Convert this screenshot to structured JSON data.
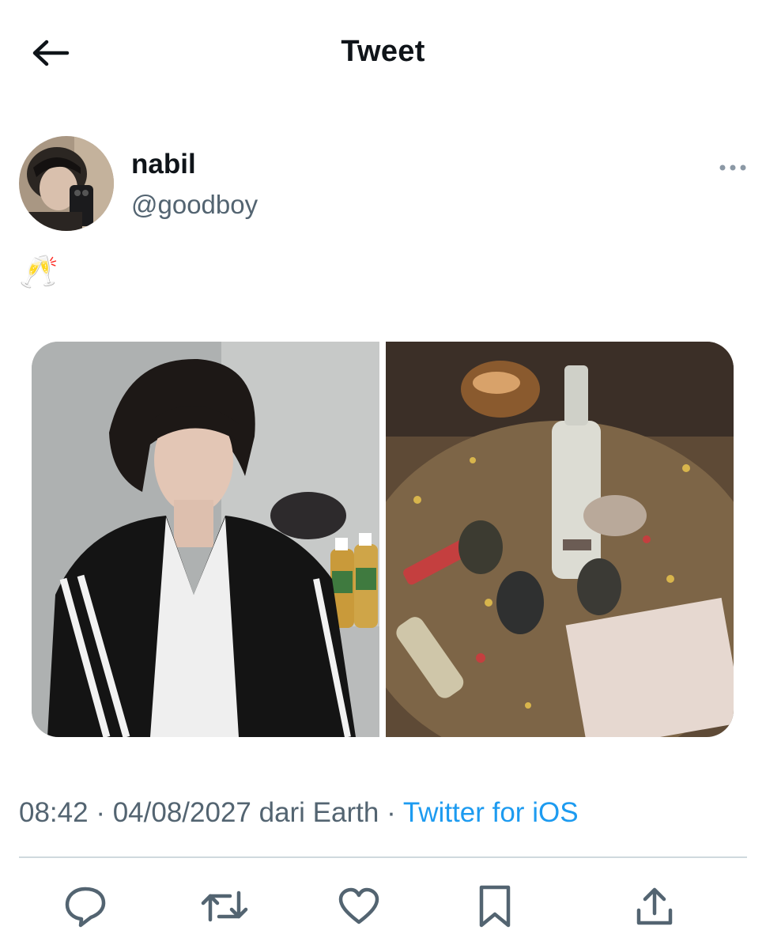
{
  "header": {
    "title": "Tweet",
    "back_icon": "arrow-left-icon"
  },
  "author": {
    "display_name": "nabil",
    "handle": "@goodboy",
    "more_icon": "more-horizontal-icon"
  },
  "tweet": {
    "text": "🥂"
  },
  "media": [
    {
      "icon": "photo-portrait"
    },
    {
      "icon": "photo-party-table"
    }
  ],
  "meta": {
    "time": "08:42",
    "sep1": " · ",
    "date": "04/08/2027",
    "location": " dari Earth",
    "sep2": " · ",
    "source": "Twitter for iOS"
  },
  "actions": [
    {
      "name": "reply-button",
      "icon": "reply-icon"
    },
    {
      "name": "retweet-button",
      "icon": "retweet-icon"
    },
    {
      "name": "like-button",
      "icon": "heart-icon"
    },
    {
      "name": "bookmark-button",
      "icon": "bookmark-icon"
    },
    {
      "name": "share-button",
      "icon": "share-icon"
    }
  ],
  "colors": {
    "text": "#0f1419",
    "secondary": "#536471",
    "accent": "#1d9bf0",
    "divider": "#cfd9de"
  }
}
